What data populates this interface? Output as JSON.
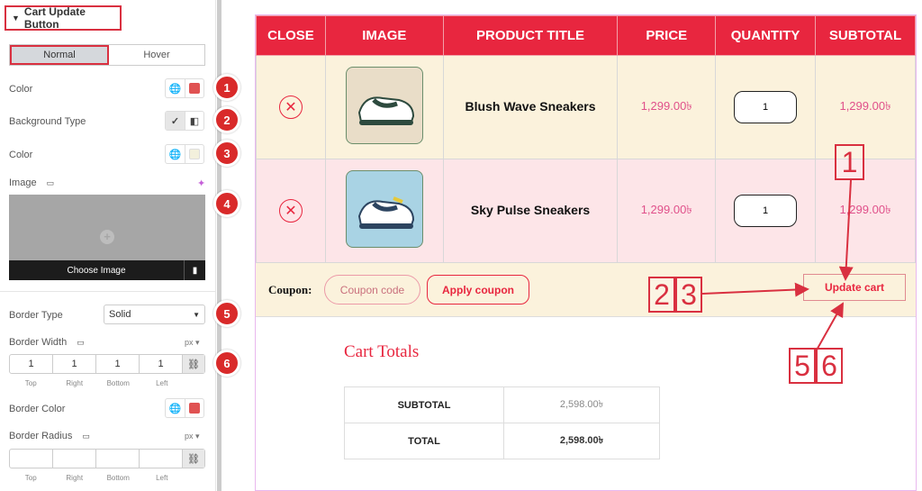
{
  "panel": {
    "section_title": "Cart Update Button",
    "tabs": [
      "Normal",
      "Hover"
    ],
    "color_label": "Color",
    "background_type_label": "Background Type",
    "color2_label": "Color",
    "image_label": "Image",
    "choose_image": "Choose Image",
    "border_type_label": "Border Type",
    "border_type_value": "Solid",
    "border_width_label": "Border Width",
    "border_width_unit": "px",
    "border_width_values": [
      "1",
      "1",
      "1",
      "1"
    ],
    "dim_labels": [
      "Top",
      "Right",
      "Bottom",
      "Left"
    ],
    "border_color_label": "Border Color",
    "border_radius_label": "Border Radius",
    "border_radius_unit": "px",
    "badges": [
      "1",
      "2",
      "3",
      "4",
      "5",
      "6"
    ],
    "colors": {
      "swatch_red": "#e05252",
      "swatch_cream": "#f3f0dc",
      "badge": "#d92a2a"
    }
  },
  "cart": {
    "headers": [
      "CLOSE",
      "IMAGE",
      "PRODUCT TITLE",
      "PRICE",
      "QUANTITY",
      "SUBTOTAL"
    ],
    "rows": [
      {
        "title": "Blush Wave Sneakers",
        "price": "1,299.00৳",
        "qty": "1",
        "subtotal": "1,299.00৳"
      },
      {
        "title": "Sky Pulse Sneakers",
        "price": "1,299.00৳",
        "qty": "1",
        "subtotal": "1,299.00৳"
      }
    ],
    "coupon_label": "Coupon:",
    "coupon_placeholder": "Coupon code",
    "apply_coupon": "Apply coupon",
    "update_cart": "Update cart",
    "colors": {
      "header": "#e8263f",
      "row1": "#fbf2dc",
      "row2": "#fde5e8",
      "price": "#e0508a"
    }
  },
  "totals": {
    "title": "Cart Totals",
    "subtotal_label": "SUBTOTAL",
    "subtotal_value": "2,598.00৳",
    "total_label": "TOTAL",
    "total_value": "2,598.00৳"
  },
  "annotations": [
    "1",
    "2",
    "3",
    "5",
    "6"
  ]
}
